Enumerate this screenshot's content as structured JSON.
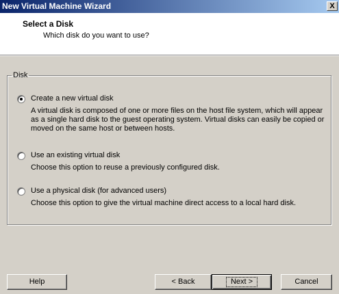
{
  "window": {
    "title": "New Virtual Machine Wizard",
    "close_label": "X"
  },
  "header": {
    "title": "Select a Disk",
    "subtitle": "Which disk do you want to use?"
  },
  "disk_group": {
    "legend": "Disk",
    "options": [
      {
        "label": "Create a new virtual disk",
        "description": "A virtual disk is composed of one or more files on the host file system, which will appear as a single hard disk to the guest operating system. Virtual disks can easily be copied or moved on the same host or between hosts.",
        "selected": true
      },
      {
        "label": "Use an existing virtual disk",
        "description": "Choose this option to reuse a previously configured disk.",
        "selected": false
      },
      {
        "label": "Use a physical disk (for advanced users)",
        "description": "Choose this option to give the virtual machine direct access to a local hard disk.",
        "selected": false
      }
    ]
  },
  "buttons": {
    "help": "Help",
    "back": "< Back",
    "next": "Next >",
    "cancel": "Cancel"
  }
}
